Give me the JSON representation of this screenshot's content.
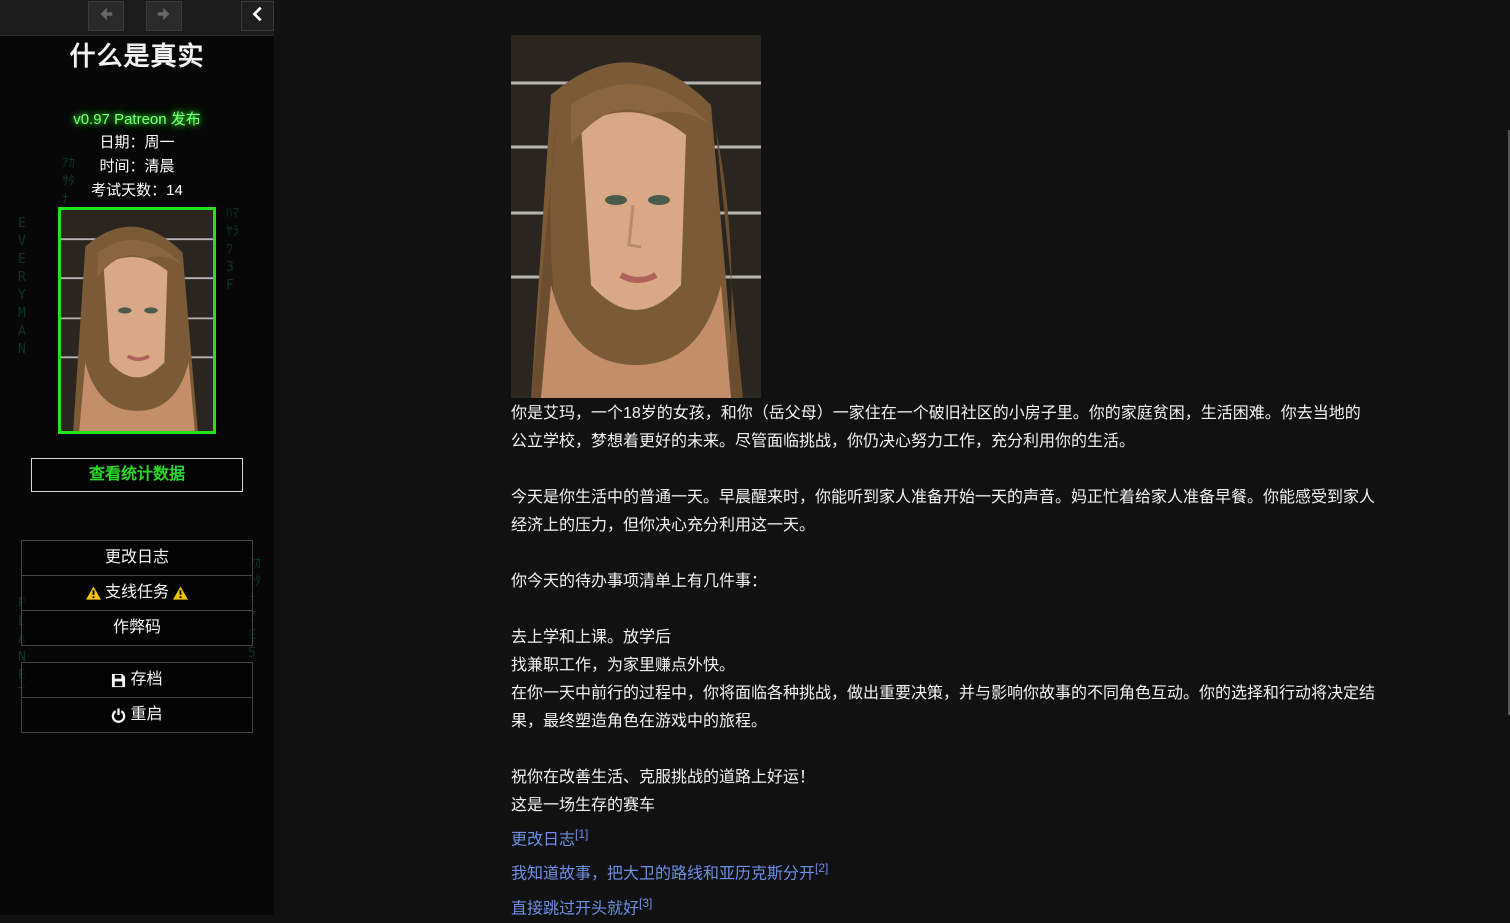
{
  "sidebar": {
    "title": "什么是真实",
    "version": "v0.97 Patreon 发布",
    "date_line": "日期：周一",
    "time_line": "时间：清晨",
    "exam_days_line": "考试天数：14",
    "stats_button": "查看统计数据",
    "menu_primary": [
      {
        "label": "更改日志"
      },
      {
        "label": "支线任务",
        "icon": "warning-icon"
      },
      {
        "label": "作弊码"
      }
    ],
    "menu_secondary": [
      {
        "label": "存档",
        "icon": "save-icon"
      },
      {
        "label": "重启",
        "icon": "power-icon"
      }
    ],
    "matrix_columns": [
      "EVERYMAN",
      "PLANET",
      "ｱｶｻﾀﾅ7E5",
      "ﾊﾏﾔﾗﾜ3F"
    ]
  },
  "passage": {
    "paragraphs": [
      [
        "你是艾玛，一个18岁的女孩，和你（岳父母）一家住在一个破旧社区的小房子里。你的家庭贫困，生活困难。你去当地的",
        "公立学校，梦想着更好的未来。尽管面临挑战，你仍决心努力工作，充分利用你的生活。"
      ],
      [
        "今天是你生活中的普通一天。早晨醒来时，你能听到家人准备开始一天的声音。妈正忙着给家人准备早餐。你能感受到家人",
        "经济上的压力，但你决心充分利用这一天。"
      ],
      [
        "你今天的待办事项清单上有几件事："
      ],
      [
        "去上学和上课。放学后",
        "找兼职工作，为家里赚点外快。",
        "在你一天中前行的过程中，你将面临各种挑战，做出重要决策，并与影响你故事的不同角色互动。你的选择和行动将决定结",
        "果，最终塑造角色在游戏中的旅程。"
      ],
      [
        "祝你在改善生活、克服挑战的道路上好运！",
        "这是一场生存的赛车"
      ]
    ],
    "links": [
      {
        "text": "更改日志",
        "ref": "[1]"
      },
      {
        "text": "我知道故事，把大卫的路线和亚历克斯分开",
        "ref": "[2]"
      },
      {
        "text": "直接跳过开头就好",
        "ref": "[3]"
      }
    ]
  },
  "colors": {
    "accent_green": "#1fe31f",
    "link_blue": "#6e8fe6",
    "background": "#111111"
  }
}
